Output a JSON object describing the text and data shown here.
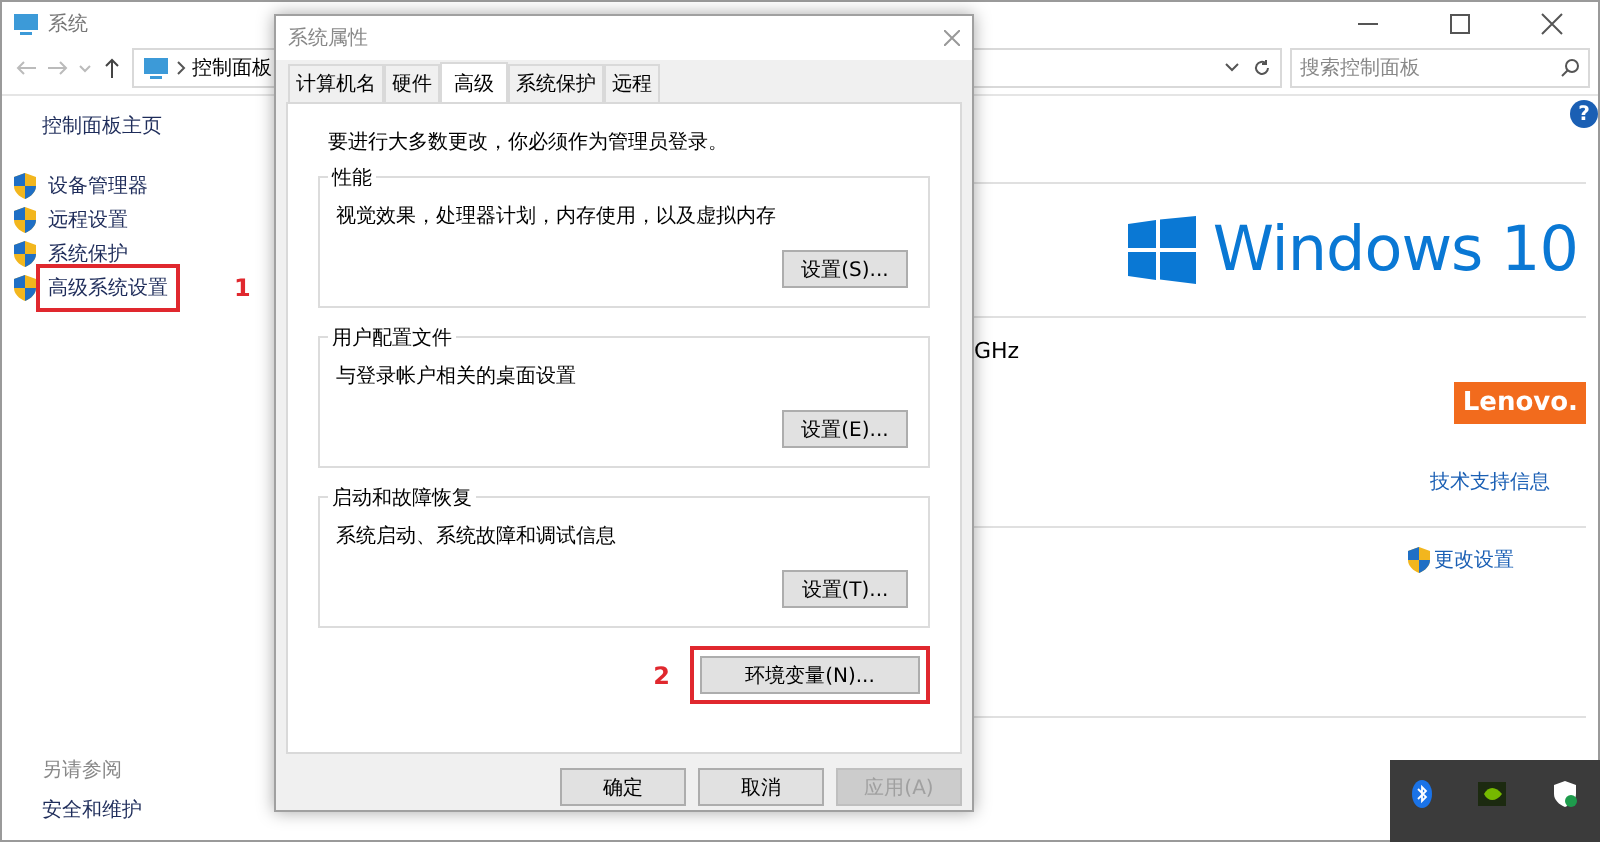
{
  "window": {
    "title": "系统"
  },
  "address": {
    "path": [
      "控制面板"
    ]
  },
  "search": {
    "placeholder": "搜索控制面板"
  },
  "sidebar": {
    "home": "控制面板主页",
    "items": [
      {
        "label": "设备管理器",
        "highlighted": false
      },
      {
        "label": "远程设置",
        "highlighted": false
      },
      {
        "label": "系统保护",
        "highlighted": false
      },
      {
        "label": "高级系统设置",
        "highlighted": true,
        "annotation": "1"
      }
    ],
    "see_also": {
      "title": "另请参阅",
      "links": [
        "安全和维护"
      ]
    }
  },
  "main": {
    "help": "?",
    "os_logo": "Windows 10",
    "processor_fragment": "GHz",
    "oem_logo": "Lenovo.",
    "support_link": "技术支持信息",
    "change_settings": "更改设置"
  },
  "dialog": {
    "title": "系统属性",
    "tabs": [
      {
        "label": "计算机名",
        "selected": false
      },
      {
        "label": "硬件",
        "selected": false
      },
      {
        "label": "高级",
        "selected": true
      },
      {
        "label": "系统保护",
        "selected": false
      },
      {
        "label": "远程",
        "selected": false
      }
    ],
    "notice": "要进行大多数更改，你必须作为管理员登录。",
    "groups": [
      {
        "title": "性能",
        "description": "视觉效果，处理器计划，内存使用，以及虚拟内存",
        "button": "设置(S)..."
      },
      {
        "title": "用户配置文件",
        "description": "与登录帐户相关的桌面设置",
        "button": "设置(E)..."
      },
      {
        "title": "启动和故障恢复",
        "description": "系统启动、系统故障和调试信息",
        "button": "设置(T)..."
      }
    ],
    "env_button": {
      "label": "环境变量(N)...",
      "highlighted": true,
      "annotation": "2"
    },
    "buttons": [
      {
        "label": "确定",
        "disabled": false
      },
      {
        "label": "取消",
        "disabled": false
      },
      {
        "label": "应用(A)",
        "disabled": true
      }
    ]
  }
}
